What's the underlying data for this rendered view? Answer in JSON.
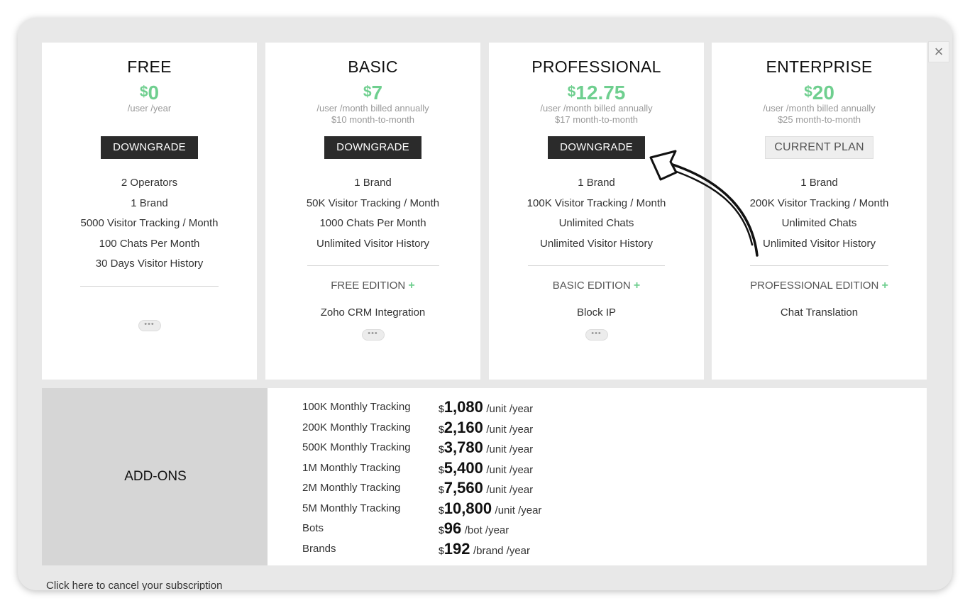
{
  "close_label": "×",
  "plans": [
    {
      "name": "FREE",
      "currency": "$",
      "price": "0",
      "note_line1": "/user /year",
      "note_line2": "",
      "button": "DOWNGRADE",
      "features": [
        "2 Operators",
        "1 Brand",
        "5000 Visitor Tracking / Month",
        "100 Chats Per Month",
        "30 Days Visitor History"
      ],
      "edition": "",
      "extra": "",
      "more": "•••"
    },
    {
      "name": "BASIC",
      "currency": "$",
      "price": "7",
      "note_line1": "/user /month billed annually",
      "note_line2": "$10 month-to-month",
      "button": "DOWNGRADE",
      "features": [
        "1 Brand",
        "50K Visitor Tracking / Month",
        "1000 Chats Per Month",
        "Unlimited Visitor History"
      ],
      "edition": "FREE EDITION",
      "extra": "Zoho CRM Integration",
      "more": "•••"
    },
    {
      "name": "PROFESSIONAL",
      "currency": "$",
      "price": "12.75",
      "note_line1": "/user /month billed annually",
      "note_line2": "$17 month-to-month",
      "button": "DOWNGRADE",
      "features": [
        "1 Brand",
        "100K Visitor Tracking / Month",
        "Unlimited Chats",
        "Unlimited Visitor History"
      ],
      "edition": "BASIC EDITION",
      "extra": "Block IP",
      "more": "•••"
    },
    {
      "name": "ENTERPRISE",
      "currency": "$",
      "price": "20",
      "note_line1": "/user /month billed annually",
      "note_line2": "$25 month-to-month",
      "button": "CURRENT PLAN",
      "features": [
        "1 Brand",
        "200K Visitor Tracking / Month",
        "Unlimited Chats",
        "Unlimited Visitor History"
      ],
      "edition": "PROFESSIONAL EDITION",
      "extra": "Chat Translation",
      "more": ""
    }
  ],
  "edition_plus": "+",
  "addons": {
    "label": "ADD-ONS",
    "items": [
      {
        "name": "100K Monthly Tracking",
        "currency": "$",
        "amount": "1,080",
        "unit": "/unit /year"
      },
      {
        "name": "200K Monthly Tracking",
        "currency": "$",
        "amount": "2,160",
        "unit": "/unit /year"
      },
      {
        "name": "500K Monthly Tracking",
        "currency": "$",
        "amount": "3,780",
        "unit": "/unit /year"
      },
      {
        "name": "1M Monthly Tracking",
        "currency": "$",
        "amount": "5,400",
        "unit": "/unit /year"
      },
      {
        "name": "2M Monthly Tracking",
        "currency": "$",
        "amount": "7,560",
        "unit": "/unit /year"
      },
      {
        "name": "5M Monthly Tracking",
        "currency": "$",
        "amount": "10,800",
        "unit": "/unit /year"
      },
      {
        "name": "Bots",
        "currency": "$",
        "amount": "96",
        "unit": "/bot /year"
      },
      {
        "name": "Brands",
        "currency": "$",
        "amount": "192",
        "unit": "/brand /year"
      }
    ]
  },
  "cancel": {
    "link": "Click here",
    "text": " to cancel your subscription"
  }
}
